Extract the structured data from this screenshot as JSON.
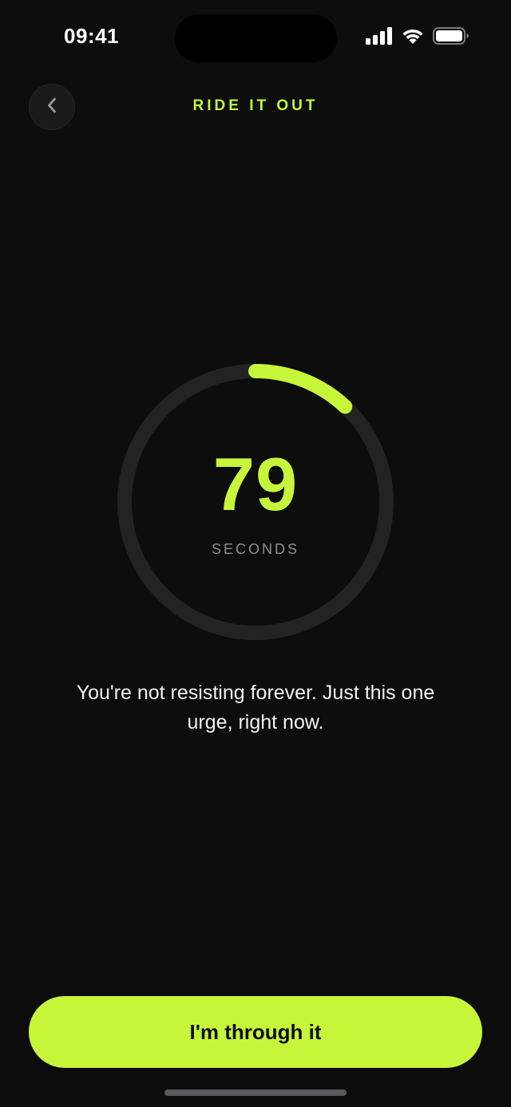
{
  "status_bar": {
    "time": "09:41"
  },
  "header": {
    "title": "RIDE IT OUT"
  },
  "timer": {
    "value": "79",
    "unit": "SECONDS",
    "progress_fraction": 0.12
  },
  "message": "You're not resisting forever. Just this one urge, right now.",
  "actions": {
    "done_label": "I'm through it"
  },
  "colors": {
    "background": "#0d0d0d",
    "accent": "#c6f53a",
    "ring_track": "#232325",
    "muted_text": "#8e8e93"
  }
}
